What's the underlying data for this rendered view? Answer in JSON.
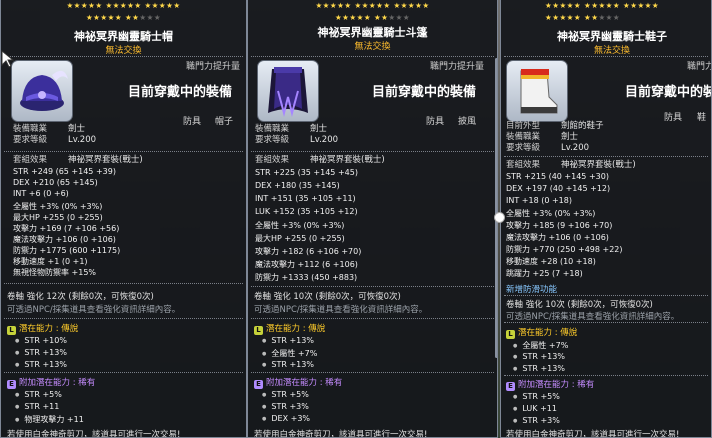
{
  "common": {
    "upgrade_label": "職門力提升量",
    "wearing_label": "目前穿戴中的裝備",
    "job_key": "裝備職業",
    "job_val": "劍士",
    "level_key": "要求等級",
    "level_val": "Lv.200",
    "set_key": "套組效果",
    "set_name": "神祕冥界套裝(戰士)",
    "tradable": "無法交換",
    "scroll_note": "可透過NPC/採集道具查看強化資訊詳細內容。",
    "pot_label": "潛在能力 : 傳說",
    "add_pot_label": "附加潛在能力 : 稀有",
    "footer": "若使用白金神奇剪刀，該道具可進行一次交易!"
  },
  "panel1": {
    "title": "神祕冥界幽靈騎士帽",
    "tags": [
      "防具",
      "帽子"
    ],
    "stats": [
      "STR +249 (65 +145 +39)",
      "DEX +210 (65 +145)",
      "INT +6 (0 +6)",
      "全屬性 +3% (0% +3%)",
      "最大HP +255 (0 +255)",
      "攻擊力 +169 (7 +106 +56)",
      "魔法攻擊力 +106 (0 +106)",
      "防禦力 +1775 (600 +1175)",
      "移動速度 +1 (0 +1)",
      "無視怪物防禦率 +15%"
    ],
    "scroll": "卷軸 強化 12次 (剩餘0次，可恢復0次)",
    "pot": [
      "STR +10%",
      "STR +13%",
      "STR +13%"
    ],
    "add_pot": [
      "STR +5%",
      "STR +11",
      "物理攻擊力 +11"
    ]
  },
  "panel2": {
    "title": "神祕冥界幽靈騎士斗篷",
    "tags": [
      "防具",
      "披風"
    ],
    "stats": [
      "STR +225 (35 +145 +45)",
      "DEX +180 (35 +145)",
      "INT +151 (35 +105 +11)",
      "LUK +152 (35 +105 +12)",
      "全屬性 +3% (0% +3%)",
      "最大HP +255 (0 +255)",
      "攻擊力 +182 (6 +106 +70)",
      "魔法攻擊力 +112 (6 +106)",
      "防禦力 +1333 (450 +883)"
    ],
    "scroll": "卷軸 強化 10次 (剩餘0次，可恢復0次)",
    "pot": [
      "STR +13%",
      "全屬性 +7%",
      "STR +13%"
    ],
    "add_pot": [
      "STR +5%",
      "STR +3%",
      "DEX +3%"
    ]
  },
  "panel3": {
    "title": "神祕冥界幽靈騎士鞋子",
    "tags": [
      "防具",
      "鞋"
    ],
    "appearance_key": "目前外型",
    "appearance_val": "劍館的鞋子",
    "stats": [
      "STR +215 (40 +145 +30)",
      "DEX +197 (40 +145 +12)",
      "INT +18 (0 +18)",
      "全屬性 +3% (0% +3%)",
      "攻擊力 +185 (9 +106 +70)",
      "魔法攻擊力 +106 (0 +106)",
      "防禦力 +770 (250 +498 +22)",
      "移動速度 +28 (10 +18)",
      "跳躍力 +25 (7 +18)"
    ],
    "new_feature": "新增防滑功能",
    "scroll": "卷軸 強化 10次 (剩餘0次，可恢復0次)",
    "pot": [
      "全屬性 +7%",
      "STR +13%",
      "STR +13%"
    ],
    "add_pot": [
      "STR +5%",
      "LUK +11",
      "STR +3%"
    ]
  }
}
